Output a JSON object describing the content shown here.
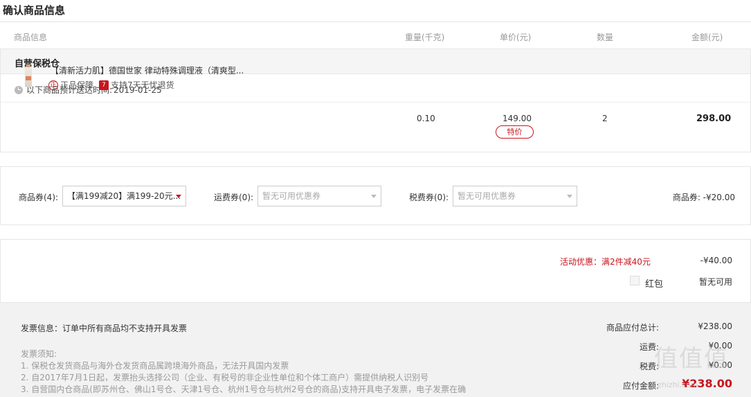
{
  "page_title": "确认商品信息",
  "columns": {
    "info": "商品信息",
    "weight": "重量(千克)",
    "unit_price": "单价(元)",
    "qty": "数量",
    "amount": "金额(元)"
  },
  "warehouse": {
    "name": "自营保税仓",
    "delivery_label": "以下商品预计送达时间:",
    "delivery_date": "2019-01-25"
  },
  "product": {
    "name": "【清新活力肌】德国世家 律动特殊调理液（清爽型...",
    "badge_genuine_icon": "正",
    "badge_genuine": "正品保障",
    "badge_return_icon": "7",
    "badge_return": "支持7天无忧退货",
    "weight": "0.10",
    "unit_price": "149.00",
    "price_tag": "特价",
    "qty": "2",
    "amount": "298.00"
  },
  "coupons": {
    "goods_label": "商品券(4):",
    "goods_value": "【满199减20】满199-20元...",
    "shipping_label": "运费券(0):",
    "shipping_value": "暂无可用优惠券",
    "tax_label": "税费券(0):",
    "tax_value": "暂无可用优惠券",
    "summary": "商品券: -¥20.00"
  },
  "promotion": {
    "text": "活动优惠：满2件减40元",
    "amount": "-¥40.00",
    "hongbao_label": "红包",
    "hongbao_status": "暂无可用"
  },
  "invoice": {
    "info": "发票信息：订单中所有商品均不支持开具发票",
    "notes_title": "发票须知:",
    "notes": [
      "1. 保税仓发货商品与海外仓发货商品属跨境海外商品，无法开具国内发票",
      "2. 自2017年7月1日起，发票抬头选择公司（企业、有税号的非企业性单位和个体工商户）需提供纳税人识别号",
      "3. 自营国内仓商品(即苏州仓、佛山1号仓、天津1号仓、杭州1号仓与杭州2号仓的商品)支持开具电子发票，电子发票在确"
    ]
  },
  "summary": {
    "goods_total_label": "商品应付总计:",
    "goods_total": "¥238.00",
    "shipping_label": "运费:",
    "shipping": "¥0.00",
    "tax_label": "税费:",
    "tax": "¥0.00",
    "pay_label": "应付金额:",
    "pay": "¥238.00"
  },
  "watermark": {
    "text": "值值值",
    "sub": "zhizhi.com"
  },
  "colors": {
    "accent": "#c9151e",
    "muted": "#999999",
    "panel_bg": "#f2f2f2"
  }
}
